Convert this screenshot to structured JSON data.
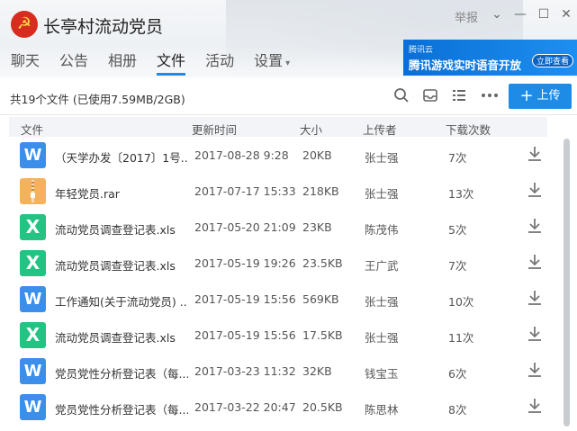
{
  "app": {
    "title": "长亭村流动党员",
    "logo_icon": "party-emblem-icon",
    "report_label": "举报",
    "window_buttons": [
      "chevron-down-icon",
      "minimize-icon",
      "maximize-icon",
      "close-icon"
    ]
  },
  "tabs": [
    {
      "label": "聊天",
      "active": false
    },
    {
      "label": "公告",
      "active": false
    },
    {
      "label": "相册",
      "active": false
    },
    {
      "label": "文件",
      "active": true
    },
    {
      "label": "活动",
      "active": false
    },
    {
      "label": "设置",
      "active": false,
      "has_caret": true
    }
  ],
  "ad": {
    "brand": "腾讯云",
    "text": "腾讯游戏实时语音开放",
    "cta": "立即查看"
  },
  "toolbar": {
    "summary": "共19个文件 (已使用7.59MB/2GB)",
    "icons": [
      "search-icon",
      "inbox-icon",
      "list-view-icon",
      "more-icon"
    ],
    "upload_label": "上传"
  },
  "columns": {
    "file": "文件",
    "time": "更新时间",
    "size": "大小",
    "uploader": "上传者",
    "downloads": "下载次数"
  },
  "files": [
    {
      "type": "doc",
      "icon_letter": "W",
      "name": "（天学办发〔2017〕1号...",
      "time": "2017-08-28 9:28",
      "size": "20KB",
      "uploader": "张士强",
      "downloads": "7次"
    },
    {
      "type": "rar",
      "icon_letter": "",
      "name": "年轻党员.rar",
      "time": "2017-07-17 15:33",
      "size": "218KB",
      "uploader": "张士强",
      "downloads": "13次"
    },
    {
      "type": "xls",
      "icon_letter": "X",
      "name": "流动党员调查登记表.xls",
      "time": "2017-05-20 21:09",
      "size": "23KB",
      "uploader": "陈茂伟",
      "downloads": "5次"
    },
    {
      "type": "xls",
      "icon_letter": "X",
      "name": "流动党员调查登记表.xls",
      "time": "2017-05-19 19:26",
      "size": "23.5KB",
      "uploader": "王广武",
      "downloads": "7次"
    },
    {
      "type": "doc",
      "icon_letter": "W",
      "name": "工作通知(关于流动党员) ...",
      "time": "2017-05-19 15:56",
      "size": "569KB",
      "uploader": "张士强",
      "downloads": "10次"
    },
    {
      "type": "xls",
      "icon_letter": "X",
      "name": "流动党员调查登记表.xls",
      "time": "2017-05-19 15:56",
      "size": "17.5KB",
      "uploader": "张士强",
      "downloads": "11次"
    },
    {
      "type": "doc",
      "icon_letter": "W",
      "name": "党员党性分析登记表（每...",
      "time": "2017-03-23 11:32",
      "size": "32KB",
      "uploader": "钱宝玉",
      "downloads": "6次"
    },
    {
      "type": "doc",
      "icon_letter": "W",
      "name": "党员党性分析登记表（每...",
      "time": "2017-03-22 20:47",
      "size": "20.5KB",
      "uploader": "陈思林",
      "downloads": "8次"
    }
  ]
}
